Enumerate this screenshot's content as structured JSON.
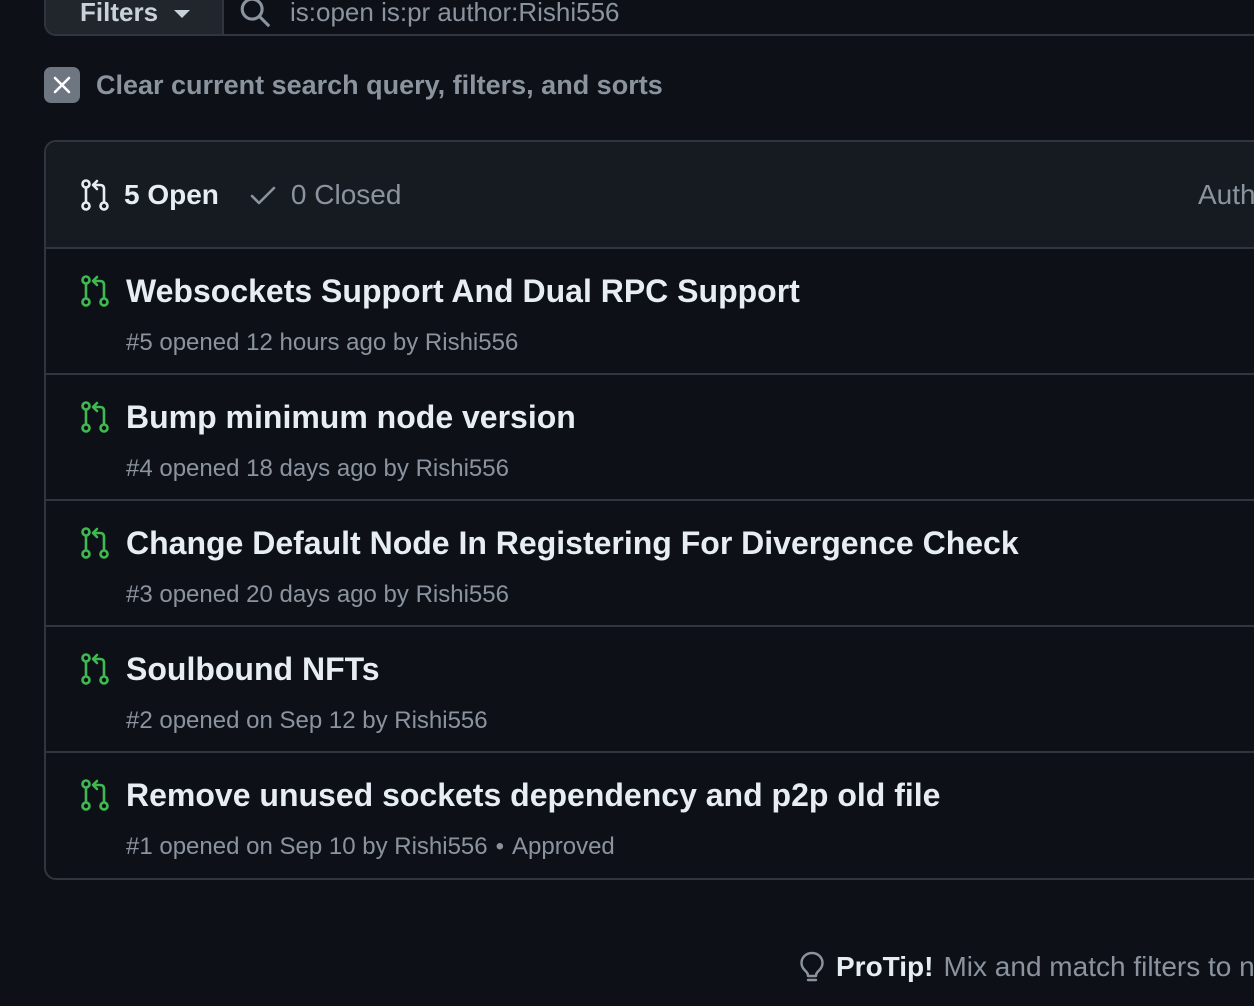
{
  "search": {
    "filters_label": "Filters",
    "query": "is:open is:pr author:Rishi556"
  },
  "clear": {
    "label": "Clear current search query, filters, and sorts"
  },
  "states": {
    "open_label": "5 Open",
    "closed_label": "0 Closed"
  },
  "header": {
    "author_label": "Author"
  },
  "pull_requests": [
    {
      "title": "Websockets Support And Dual RPC Support",
      "meta": "#5 opened 12 hours ago by Rishi556",
      "status": ""
    },
    {
      "title": "Bump minimum node version",
      "meta": "#4 opened 18 days ago by Rishi556",
      "status": ""
    },
    {
      "title": "Change Default Node In Registering For Divergence Check",
      "meta": "#3 opened 20 days ago by Rishi556",
      "status": ""
    },
    {
      "title": "Soulbound NFTs",
      "meta": "#2 opened on Sep 12 by Rishi556",
      "status": ""
    },
    {
      "title": "Remove unused sockets dependency and p2p old file",
      "meta": "#1 opened on Sep 10 by Rishi556",
      "status": "Approved"
    }
  ],
  "protip": {
    "bold": "ProTip!",
    "text": "Mix and match filters to narrow down what you're looking for."
  },
  "colors": {
    "background": "#0d1117",
    "open_icon": "#3fb950",
    "muted_text": "#8b949e",
    "border": "#30363d"
  },
  "icons": {
    "open_pr": "git-pull-request-icon",
    "closed": "check-icon",
    "search": "search-icon",
    "clear": "x-icon",
    "protip": "light-bulb-icon"
  }
}
